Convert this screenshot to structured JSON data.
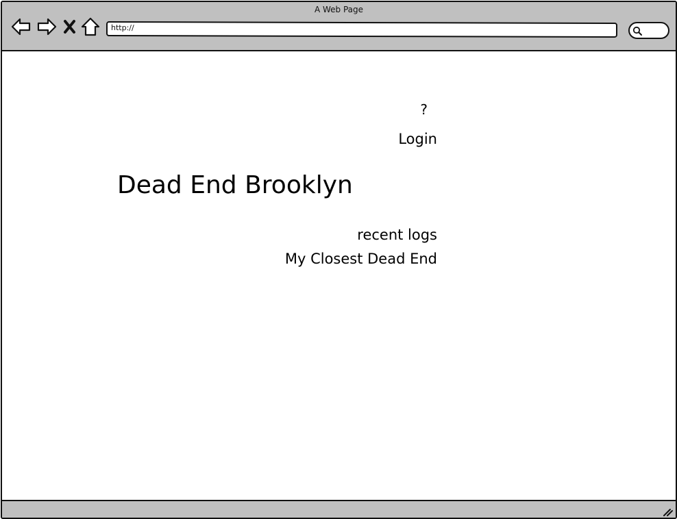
{
  "window": {
    "title": "A Web Page"
  },
  "toolbar": {
    "back_icon": "back-arrow-icon",
    "forward_icon": "forward-arrow-icon",
    "stop_icon": "close-x-icon",
    "home_icon": "home-icon",
    "address_value": "http://",
    "search_icon": "search-icon"
  },
  "page": {
    "help_link": "?",
    "login_link": "Login",
    "title": "Dead End Brooklyn",
    "nav_links": [
      {
        "label": "recent logs"
      },
      {
        "label": "My Closest Dead End"
      }
    ]
  },
  "statusbar": {
    "resize_icon": "resize-grip-icon"
  },
  "colors": {
    "chrome_gray": "#c0c0c0",
    "outline": "#111111",
    "background": "#ffffff"
  }
}
